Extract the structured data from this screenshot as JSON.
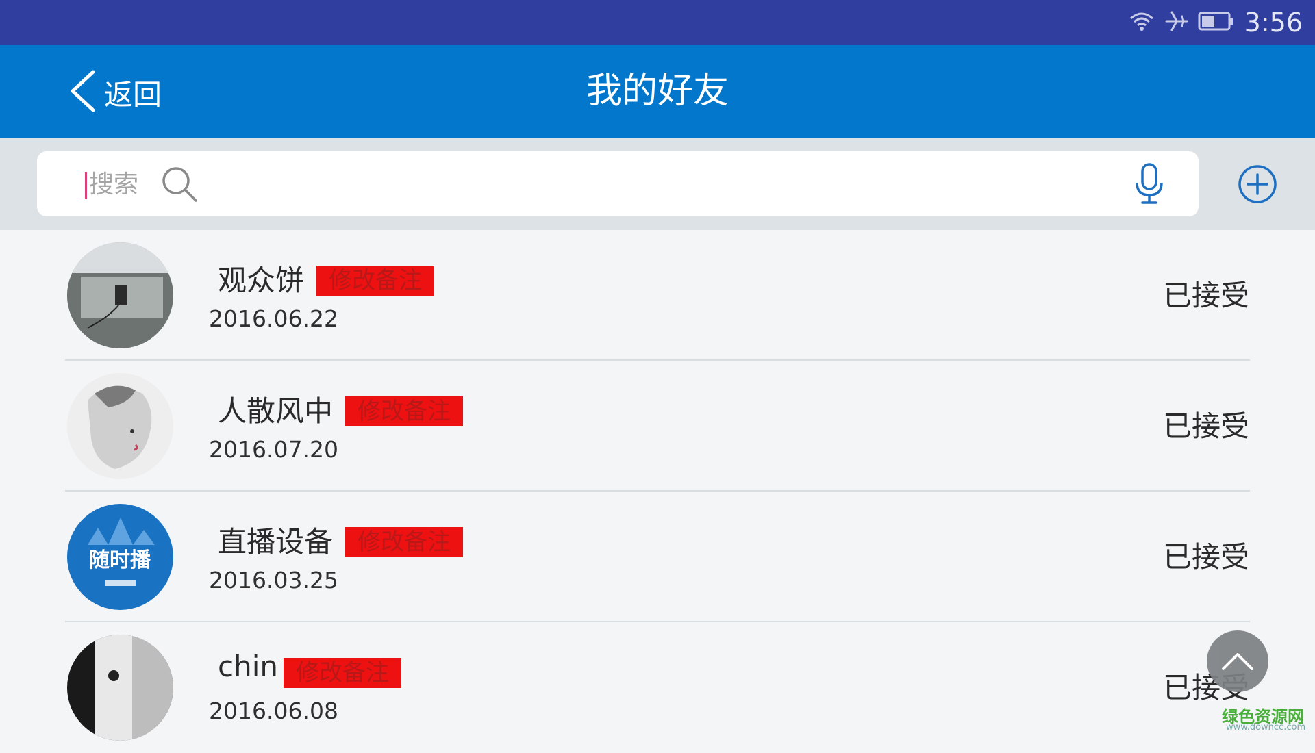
{
  "status_bar": {
    "time": "3:56",
    "icons": [
      "wifi-icon",
      "airplane-mode-icon",
      "battery-icon"
    ]
  },
  "header": {
    "back_label": "返回",
    "title": "我的好友"
  },
  "search": {
    "placeholder": "搜索",
    "value": ""
  },
  "friends": [
    {
      "name": "观众饼",
      "remark_button": "修改备注",
      "date": "2016.06.22",
      "status": "已接受"
    },
    {
      "name": "人散风中",
      "remark_button": "修改备注",
      "date": "2016.07.20",
      "status": "已接受"
    },
    {
      "name": "直播设备",
      "remark_button": "修改备注",
      "date": "2016.03.25",
      "status": "已接受"
    },
    {
      "name": "chin",
      "remark_button": "修改备注",
      "date": "2016.06.08",
      "status": "已接受"
    }
  ],
  "avatar_3_text": "随时播",
  "watermark": {
    "text": "绿色资源网",
    "url": "www.downcc.com"
  },
  "colors": {
    "status_bar": "#303f9f",
    "header": "#0277cc",
    "remark_button": "#ee1111",
    "icon_blue": "#1e6fc0"
  }
}
